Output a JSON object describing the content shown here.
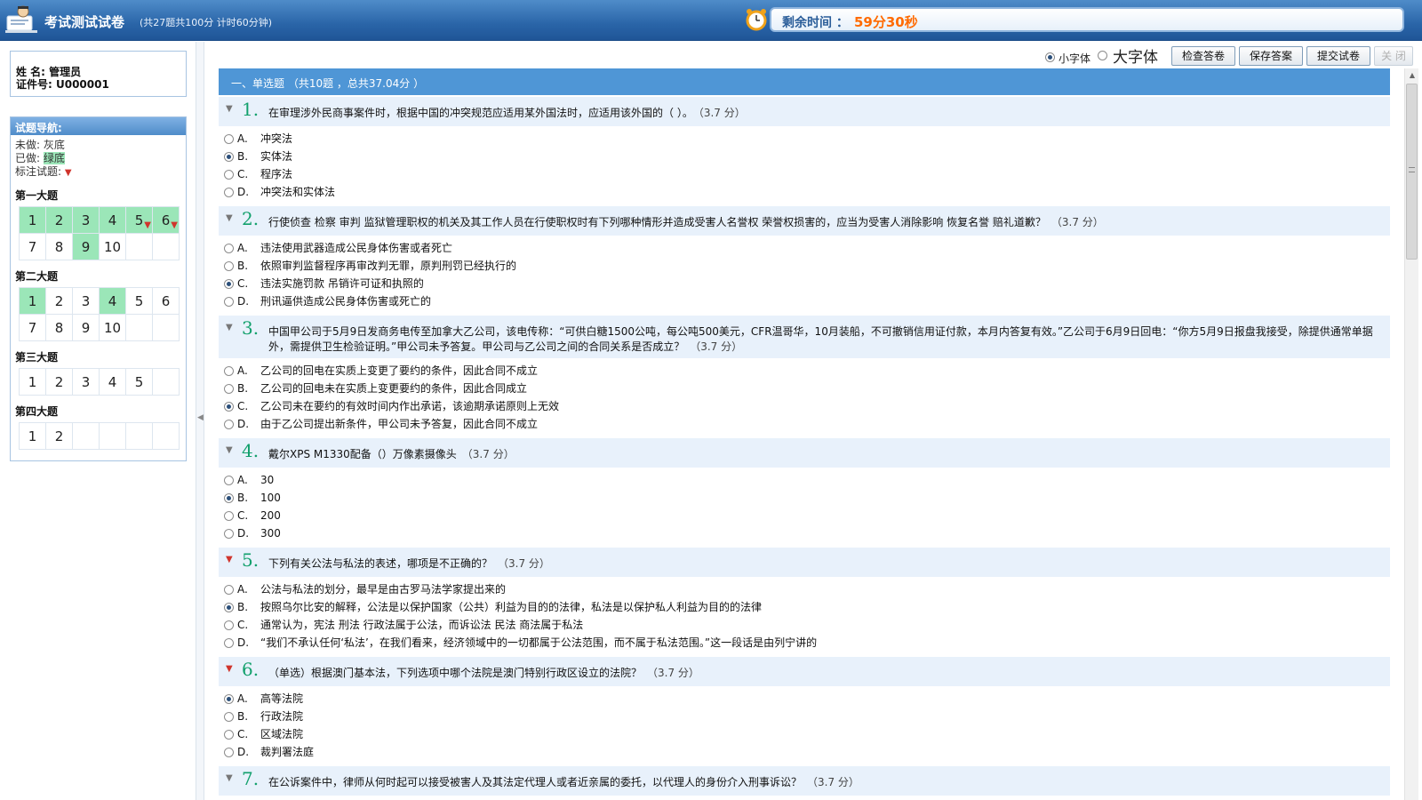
{
  "header": {
    "title": "考试测试试卷",
    "subtitle": "(共27题共100分  计时60分钟)",
    "timer_label": "剩余时间 ：",
    "timer_value": "59分30秒"
  },
  "user": {
    "name_line": "姓  名: 管理员",
    "id_line": "证件号: U000001"
  },
  "nav": {
    "title": "试题导航:",
    "legend": {
      "undone_label": "未做:",
      "undone_value": "灰底",
      "done_label": "已做:",
      "done_value": "绿底",
      "flag_label": "标注试题:"
    },
    "sections": [
      {
        "title": "第一大题",
        "items": [
          "1",
          "2",
          "3",
          "4",
          "5",
          "6",
          "7",
          "8",
          "9",
          "10"
        ]
      },
      {
        "title": "第二大题",
        "items": [
          "1",
          "2",
          "3",
          "4",
          "5",
          "6",
          "7",
          "8",
          "9",
          "10"
        ]
      },
      {
        "title": "第三大题",
        "items": [
          "1",
          "2",
          "3",
          "4",
          "5"
        ]
      },
      {
        "title": "第四大题",
        "items": [
          "1",
          "2"
        ]
      }
    ]
  },
  "toolbar": {
    "small_font": "小字体",
    "large_font": "大字体",
    "check": "检查答卷",
    "save": "保存答案",
    "submit": "提交试卷",
    "close": "关 闭"
  },
  "section_header": "一、单选题  （共10题 ，总共37.04分 ）",
  "questions": [
    {
      "num": "1.",
      "text": "在审理涉外民商事案件时，根据中国的冲突规范应适用某外国法时，应适用该外国的（ ）。",
      "score": "（3.7 分）",
      "options": [
        {
          "letter": "A.",
          "text": "冲突法"
        },
        {
          "letter": "B.",
          "text": "实体法"
        },
        {
          "letter": "C.",
          "text": "程序法"
        },
        {
          "letter": "D.",
          "text": "冲突法和实体法"
        }
      ]
    },
    {
      "num": "2.",
      "text": "行使侦查 检察 审判 监狱管理职权的机关及其工作人员在行使职权时有下列哪种情形并造成受害人名誉权 荣誉权损害的，应当为受害人消除影响 恢复名誉 赔礼道歉？",
      "score": "（3.7 分）",
      "options": [
        {
          "letter": "A.",
          "text": "违法使用武器造成公民身体伤害或者死亡"
        },
        {
          "letter": "B.",
          "text": "依照审判监督程序再审改判无罪，原判刑罚已经执行的"
        },
        {
          "letter": "C.",
          "text": "违法实施罚款 吊销许可证和执照的"
        },
        {
          "letter": "D.",
          "text": "刑讯逼供造成公民身体伤害或死亡的"
        }
      ]
    },
    {
      "num": "3.",
      "text": "中国甲公司于5月9日发商务电传至加拿大乙公司，该电传称：“可供白糖1500公吨，每公吨500美元，CFR温哥华，10月装船，不可撤销信用证付款，本月内答复有效。”乙公司于6月9日回电：“你方5月9日报盘我接受，除提供通常单据外，需提供卫生检验证明。”甲公司未予答复。甲公司与乙公司之间的合同关系是否成立？",
      "score": "（3.7 分）",
      "options": [
        {
          "letter": "A.",
          "text": "乙公司的回电在实质上变更了要约的条件，因此合同不成立"
        },
        {
          "letter": "B.",
          "text": "乙公司的回电未在实质上变更要约的条件，因此合同成立"
        },
        {
          "letter": "C.",
          "text": "乙公司未在要约的有效时间内作出承诺，该逾期承诺原则上无效"
        },
        {
          "letter": "D.",
          "text": "由于乙公司提出新条件，甲公司未予答复，因此合同不成立"
        }
      ]
    },
    {
      "num": "4.",
      "text": "戴尔XPS M1330配备（）万像素摄像头",
      "score": "（3.7 分）",
      "options": [
        {
          "letter": "A.",
          "text": "30"
        },
        {
          "letter": "B.",
          "text": "100"
        },
        {
          "letter": "C.",
          "text": "200"
        },
        {
          "letter": "D.",
          "text": "300"
        }
      ]
    },
    {
      "num": "5.",
      "text": "下列有关公法与私法的表述，哪项是不正确的？",
      "score": "（3.7 分）",
      "options": [
        {
          "letter": "A.",
          "text": "公法与私法的划分，最早是由古罗马法学家提出来的"
        },
        {
          "letter": "B.",
          "text": "按照乌尔比安的解释，公法是以保护国家（公共）利益为目的的法律，私法是以保护私人利益为目的的法律"
        },
        {
          "letter": "C.",
          "text": "通常认为，宪法 刑法 行政法属于公法，而诉讼法 民法 商法属于私法"
        },
        {
          "letter": "D.",
          "text": "“我们不承认任何‘私法’，在我们看来，经济领域中的一切都属于公法范围，而不属于私法范围。”这一段话是由列宁讲的"
        }
      ]
    },
    {
      "num": "6.",
      "text": "（单选）根据澳门基本法，下列选项中哪个法院是澳门特别行政区设立的法院？",
      "score": "（3.7 分）",
      "options": [
        {
          "letter": "A.",
          "text": "高等法院"
        },
        {
          "letter": "B.",
          "text": "行政法院"
        },
        {
          "letter": "C.",
          "text": "区域法院"
        },
        {
          "letter": "D.",
          "text": "裁判署法庭"
        }
      ]
    },
    {
      "num": "7.",
      "text": "在公诉案件中，律师从何时起可以接受被害人及其法定代理人或者近亲属的委托，以代理人的身份介入刑事诉讼？",
      "score": "（3.7 分）",
      "options": []
    }
  ]
}
